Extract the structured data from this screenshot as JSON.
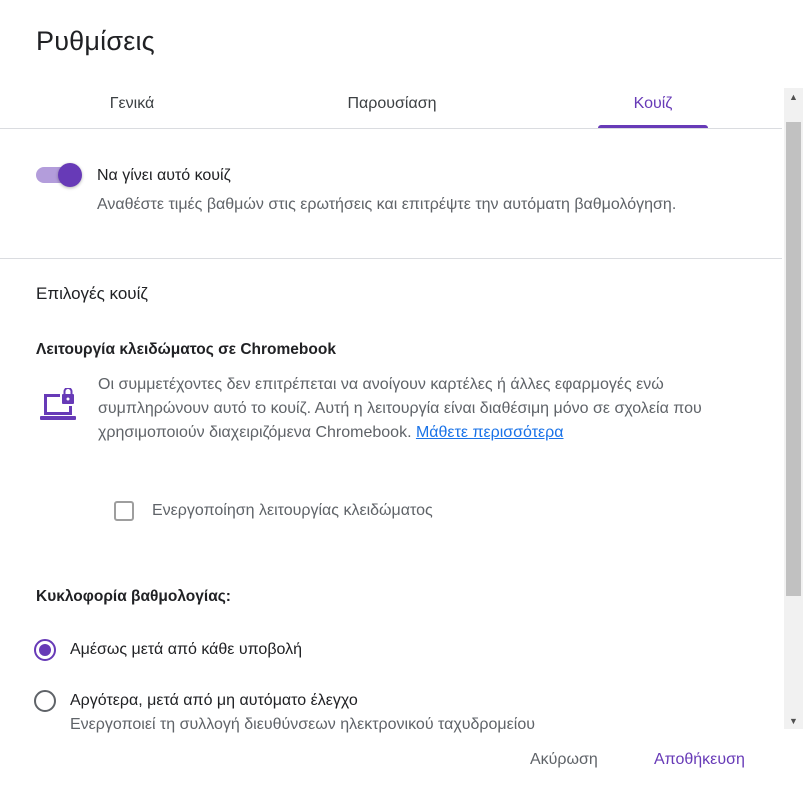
{
  "dialog": {
    "title": "Ρυθμίσεις"
  },
  "tabs": [
    {
      "label": "Γενικά"
    },
    {
      "label": "Παρουσίαση"
    },
    {
      "label": "Κουίζ"
    }
  ],
  "quiz_toggle": {
    "title": "Να γίνει αυτό κουίζ",
    "description": "Αναθέστε τιμές βαθμών στις ερωτήσεις και επιτρέψτε την αυτόματη βαθμολόγηση.",
    "enabled": true
  },
  "quiz_options": {
    "heading": "Επιλογές κουίζ"
  },
  "locked_mode": {
    "heading": "Λειτουργία κλειδώματος σε Chromebook",
    "description": "Οι συμμετέχοντες δεν επιτρέπεται να ανοίγουν καρτέλες ή άλλες εφαρμογές ενώ συμπληρώνουν αυτό το κουίζ. Αυτή η λειτουργία είναι διαθέσιμη μόνο σε σχολεία που χρησιμοποιούν διαχειριζόμενα Chromebook.",
    "learn_more": "Μάθετε περισσότερα",
    "checkbox_label": "Ενεργοποίηση λειτουργίας κλειδώματος",
    "checked": false
  },
  "grade_release": {
    "heading": "Κυκλοφορία βαθμολογίας:",
    "options": [
      {
        "label": "Αμέσως μετά από κάθε υποβολή",
        "checked": true
      },
      {
        "label": "Αργότερα, μετά από μη αυτόματο έλεγχο",
        "sublabel": "Ενεργοποιεί τη συλλογή διευθύνσεων ηλεκτρονικού ταχυδρομείου",
        "checked": false
      }
    ]
  },
  "footer": {
    "cancel_label": "Ακύρωση",
    "save_label": "Αποθήκευση"
  },
  "colors": {
    "accent": "#673ab7",
    "toggle_track": "#b39ddb",
    "link": "#1a73e8"
  }
}
